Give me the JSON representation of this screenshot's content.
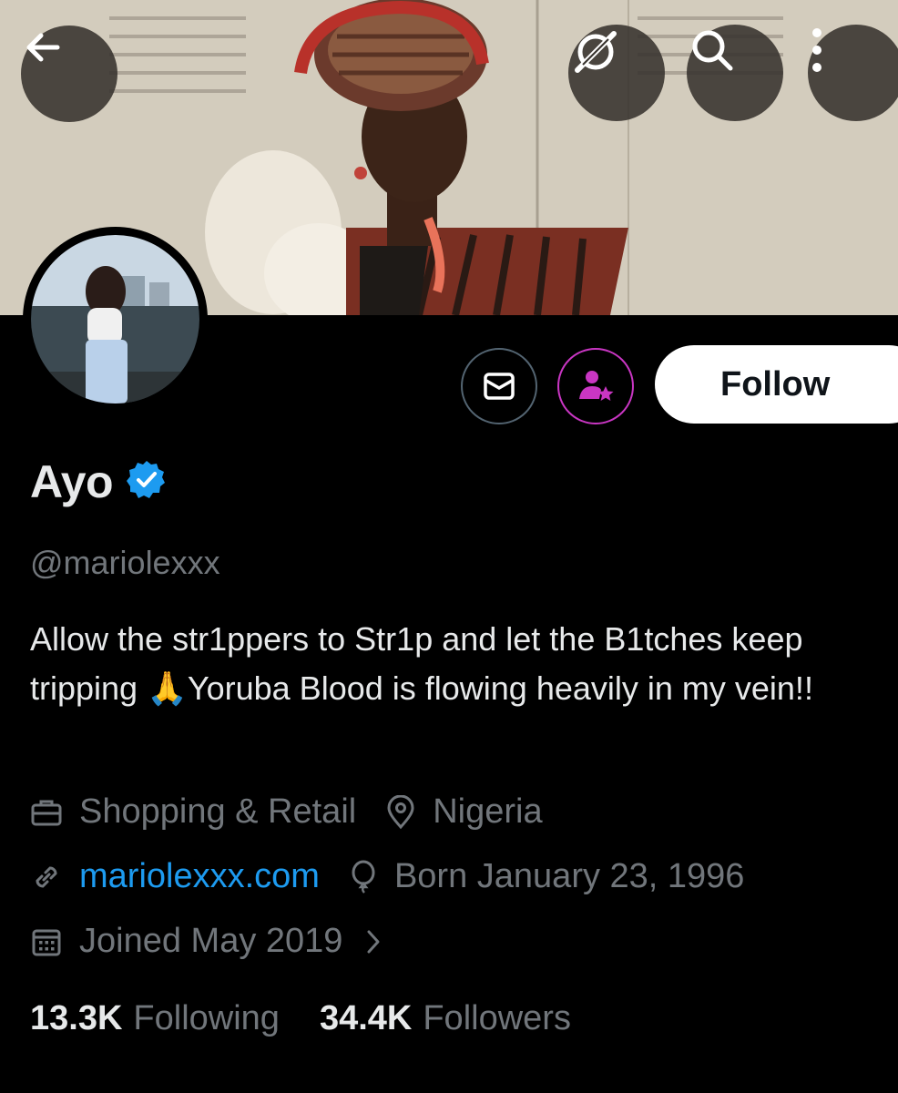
{
  "profile": {
    "name": "Ayo",
    "handle": "@mariolexxx",
    "bio": "Allow the str1ppers to Str1p and let the B1tches keep tripping 🙏Yoruba Blood is flowing heavily in my vein!!",
    "category": "Shopping & Retail",
    "location": "Nigeria",
    "website": "mariolexxx.com",
    "birthday": "Born January 23, 1996",
    "joined": "Joined May 2019",
    "following_count": "13.3K",
    "following_label": "Following",
    "followers_count": "34.4K",
    "followers_label": "Followers"
  },
  "actions": {
    "follow_label": "Follow"
  },
  "icons": {
    "back": "back-arrow-icon",
    "grok": "grok-icon",
    "search": "search-icon",
    "more": "more-vertical-icon",
    "message": "envelope-icon",
    "subscribe": "subscribe-icon",
    "verified": "verified-badge-icon",
    "category": "briefcase-icon",
    "location": "location-pin-icon",
    "website": "link-icon",
    "birthday": "balloon-icon",
    "joined": "calendar-icon",
    "chevron": "chevron-right-icon"
  },
  "colors": {
    "background": "#000000",
    "text_primary": "#e7e9ea",
    "text_secondary": "#71767b",
    "link": "#1d9bf0",
    "verified": "#1d9bf0",
    "subscribe": "#c936c3",
    "follow_bg": "#ffffff"
  }
}
